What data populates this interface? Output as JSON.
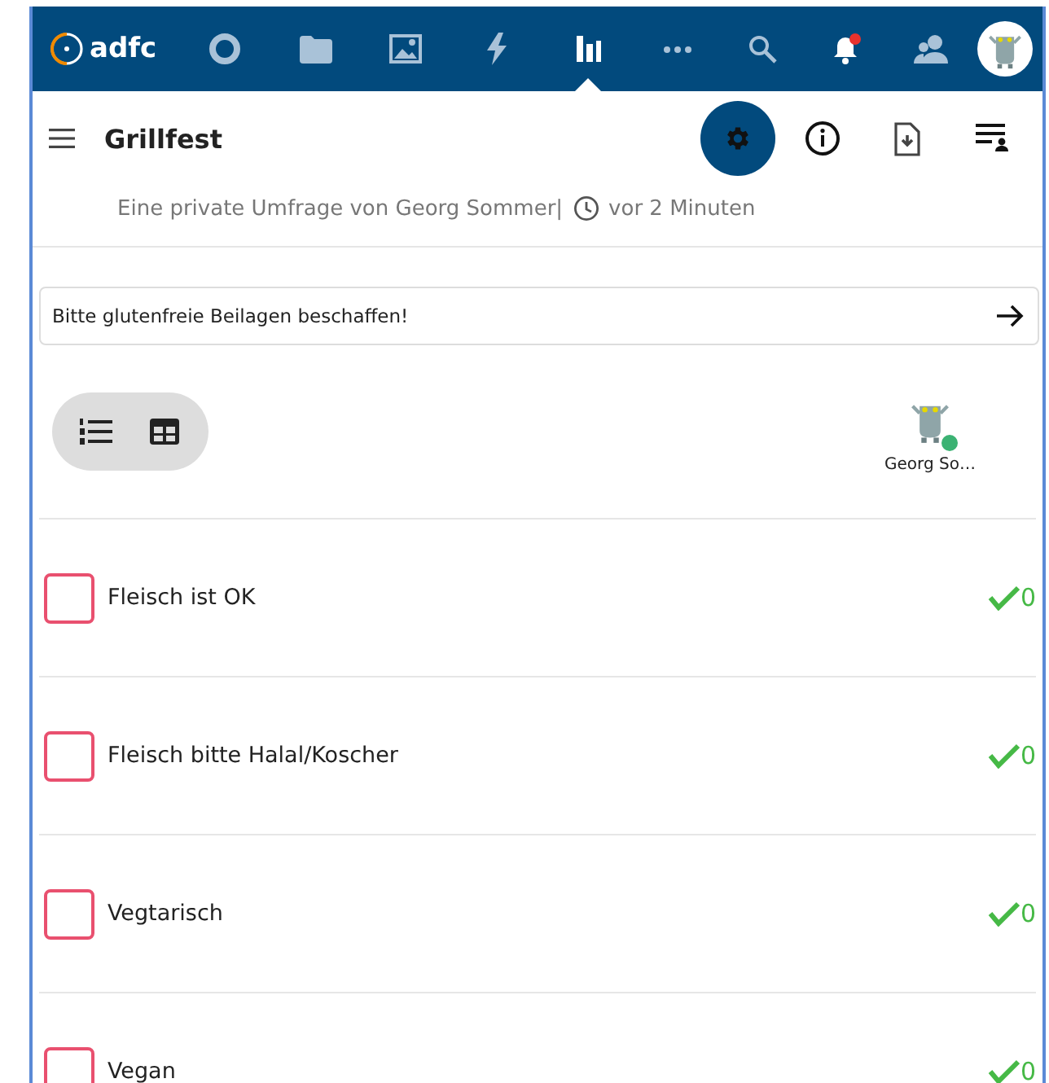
{
  "header": {
    "logo": "adfc",
    "apps": [
      {
        "kind": "circle",
        "selected": false
      },
      {
        "kind": "files",
        "selected": false
      },
      {
        "kind": "photos",
        "selected": false
      },
      {
        "kind": "activity",
        "selected": false
      },
      {
        "kind": "polls",
        "selected": true
      },
      {
        "kind": "more",
        "selected": false
      }
    ],
    "notifications_unread": true
  },
  "poll": {
    "title": "Grillfest",
    "owner_line": "Eine private Umfrage von Georg Sommer|",
    "time": "vor 2 Minuten",
    "settings_open": true
  },
  "comment": {
    "value": "Bitte glutenfreie Beilagen beschaffen!"
  },
  "participants": [
    {
      "name": "Georg So…",
      "online": true
    }
  ],
  "options": [
    {
      "text": "Fleisch ist OK",
      "checked": false,
      "count": "0"
    },
    {
      "text": "Fleisch bitte Halal/Koscher",
      "checked": false,
      "count": "0"
    },
    {
      "text": "Vegtarisch",
      "checked": false,
      "count": "0"
    },
    {
      "text": "Vegan",
      "checked": false,
      "count": "0"
    }
  ]
}
